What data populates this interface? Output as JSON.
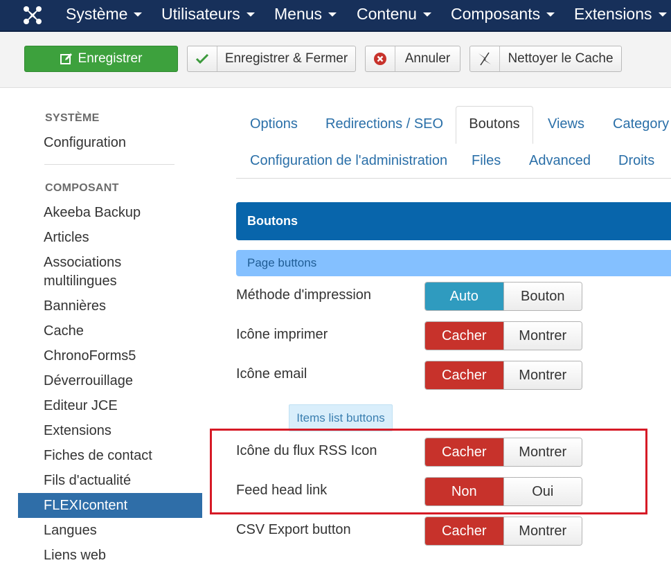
{
  "nav": {
    "items": [
      {
        "label": "Système"
      },
      {
        "label": "Utilisateurs"
      },
      {
        "label": "Menus"
      },
      {
        "label": "Contenu"
      },
      {
        "label": "Composants"
      },
      {
        "label": "Extensions"
      }
    ]
  },
  "toolbar": {
    "save_label": "Enregistrer",
    "save_close_label": "Enregistrer & Fermer",
    "cancel_label": "Annuler",
    "clear_cache_label": "Nettoyer le Cache"
  },
  "sidebar": {
    "system_heading": "SYSTÈME",
    "configuration": "Configuration",
    "component_heading": "COMPOSANT",
    "items": [
      "Akeeba Backup",
      "Articles",
      "Associations",
      "multilingues",
      "Bannières",
      "Cache",
      "ChronoForms5",
      "Déverrouillage",
      "Editeur JCE",
      "Extensions",
      "Fiches de contact",
      "Fils d'actualité",
      "FLEXIcontent",
      "Langues",
      "Liens web"
    ]
  },
  "tabs": {
    "row1": [
      "Options",
      "Redirections / SEO",
      "Boutons",
      "Views",
      "Category"
    ],
    "row2": [
      "Configuration de l'administration",
      "Files",
      "Advanced",
      "Droits"
    ]
  },
  "panel": {
    "title": "Boutons",
    "section_page": "Page buttons",
    "section_items": "Items list buttons"
  },
  "fields": [
    {
      "label": "Méthode d'impression",
      "off": "Auto",
      "on": "Bouton",
      "selected": "first"
    },
    {
      "label": "Icône imprimer",
      "off": "Cacher",
      "on": "Montrer",
      "selected": "first"
    },
    {
      "label": "Icône email",
      "off": "Cacher",
      "on": "Montrer",
      "selected": "first"
    },
    {
      "label": "Icône du flux RSS Icon",
      "off": "Cacher",
      "on": "Montrer",
      "selected": "first"
    },
    {
      "label": "Feed head link",
      "off": "Non",
      "on": "Oui",
      "selected": "first"
    },
    {
      "label": "CSV Export button",
      "off": "Cacher",
      "on": "Montrer",
      "selected": "first"
    }
  ],
  "colors": {
    "navbar": "#17305a",
    "save_green": "#3da13d",
    "danger_red": "#c7322b",
    "info_blue": "#2f9bbf",
    "panel_blue": "#0865ab",
    "active_sidebar": "#2f6ea8",
    "highlight_red": "#d61a26"
  }
}
